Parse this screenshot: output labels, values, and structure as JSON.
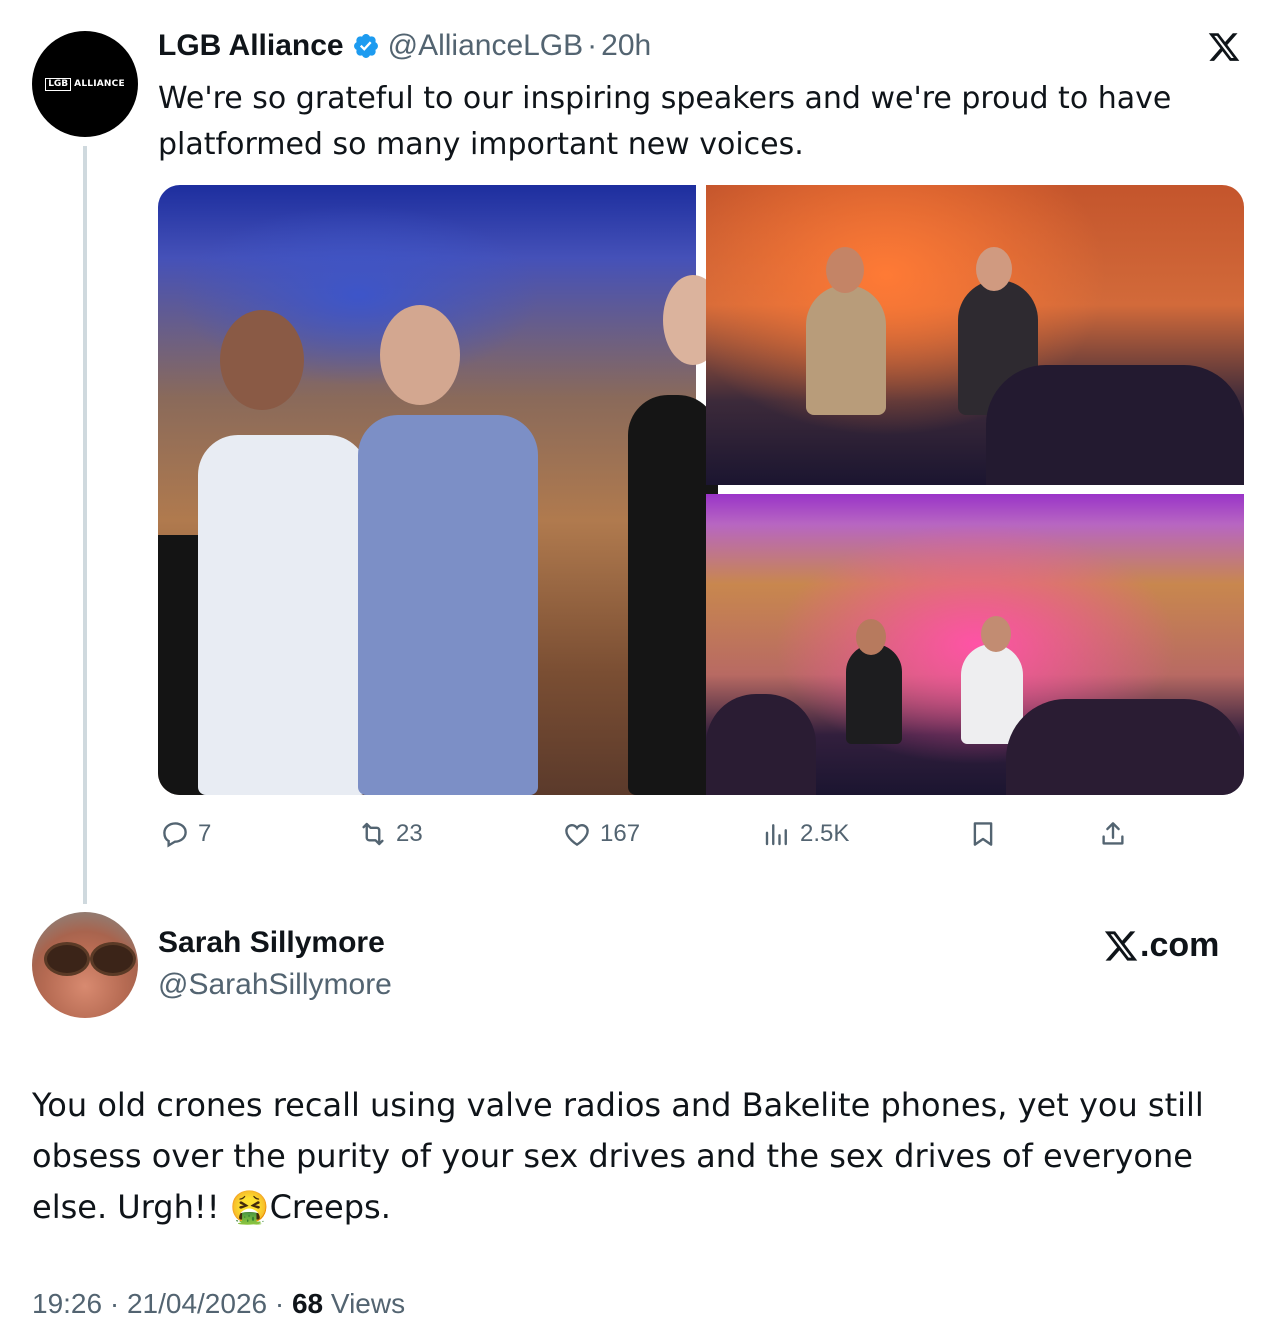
{
  "quoted_tweet": {
    "author_name": "LGB Alliance",
    "handle": "@AllianceLGB",
    "separator": "·",
    "time": "20h",
    "avatar_logo": {
      "box_text": "LGB",
      "rest_text": "ALLIANCE"
    },
    "text": "We're so grateful to our inspiring speakers and we're proud to have platformed so many important new voices.",
    "verified": true,
    "verified_color": "#1d9bf0",
    "actions": {
      "replies": "7",
      "reposts": "23",
      "likes": "167",
      "views": "2.5K"
    }
  },
  "reply": {
    "author_name": "Sarah Sillymore",
    "handle": "@SarahSillymore",
    "brand": ".com",
    "text": "You old crones recall using valve radios and Bakelite phones, yet you still obsess over the purity of your sex drives and the sex drives of everyone else.  Urgh!! 🤮Creeps.",
    "timestamp": "19:26 · 21/04/2026 · ",
    "views_count": "68",
    "views_label": " Views"
  },
  "icons": [
    "x-logo-icon",
    "verified-badge-icon",
    "reply-icon",
    "repost-icon",
    "like-icon",
    "views-icon",
    "bookmark-icon",
    "share-icon"
  ],
  "colors": {
    "text": "#0f1419",
    "secondary": "#536471",
    "thread_line": "#cfd9de"
  }
}
